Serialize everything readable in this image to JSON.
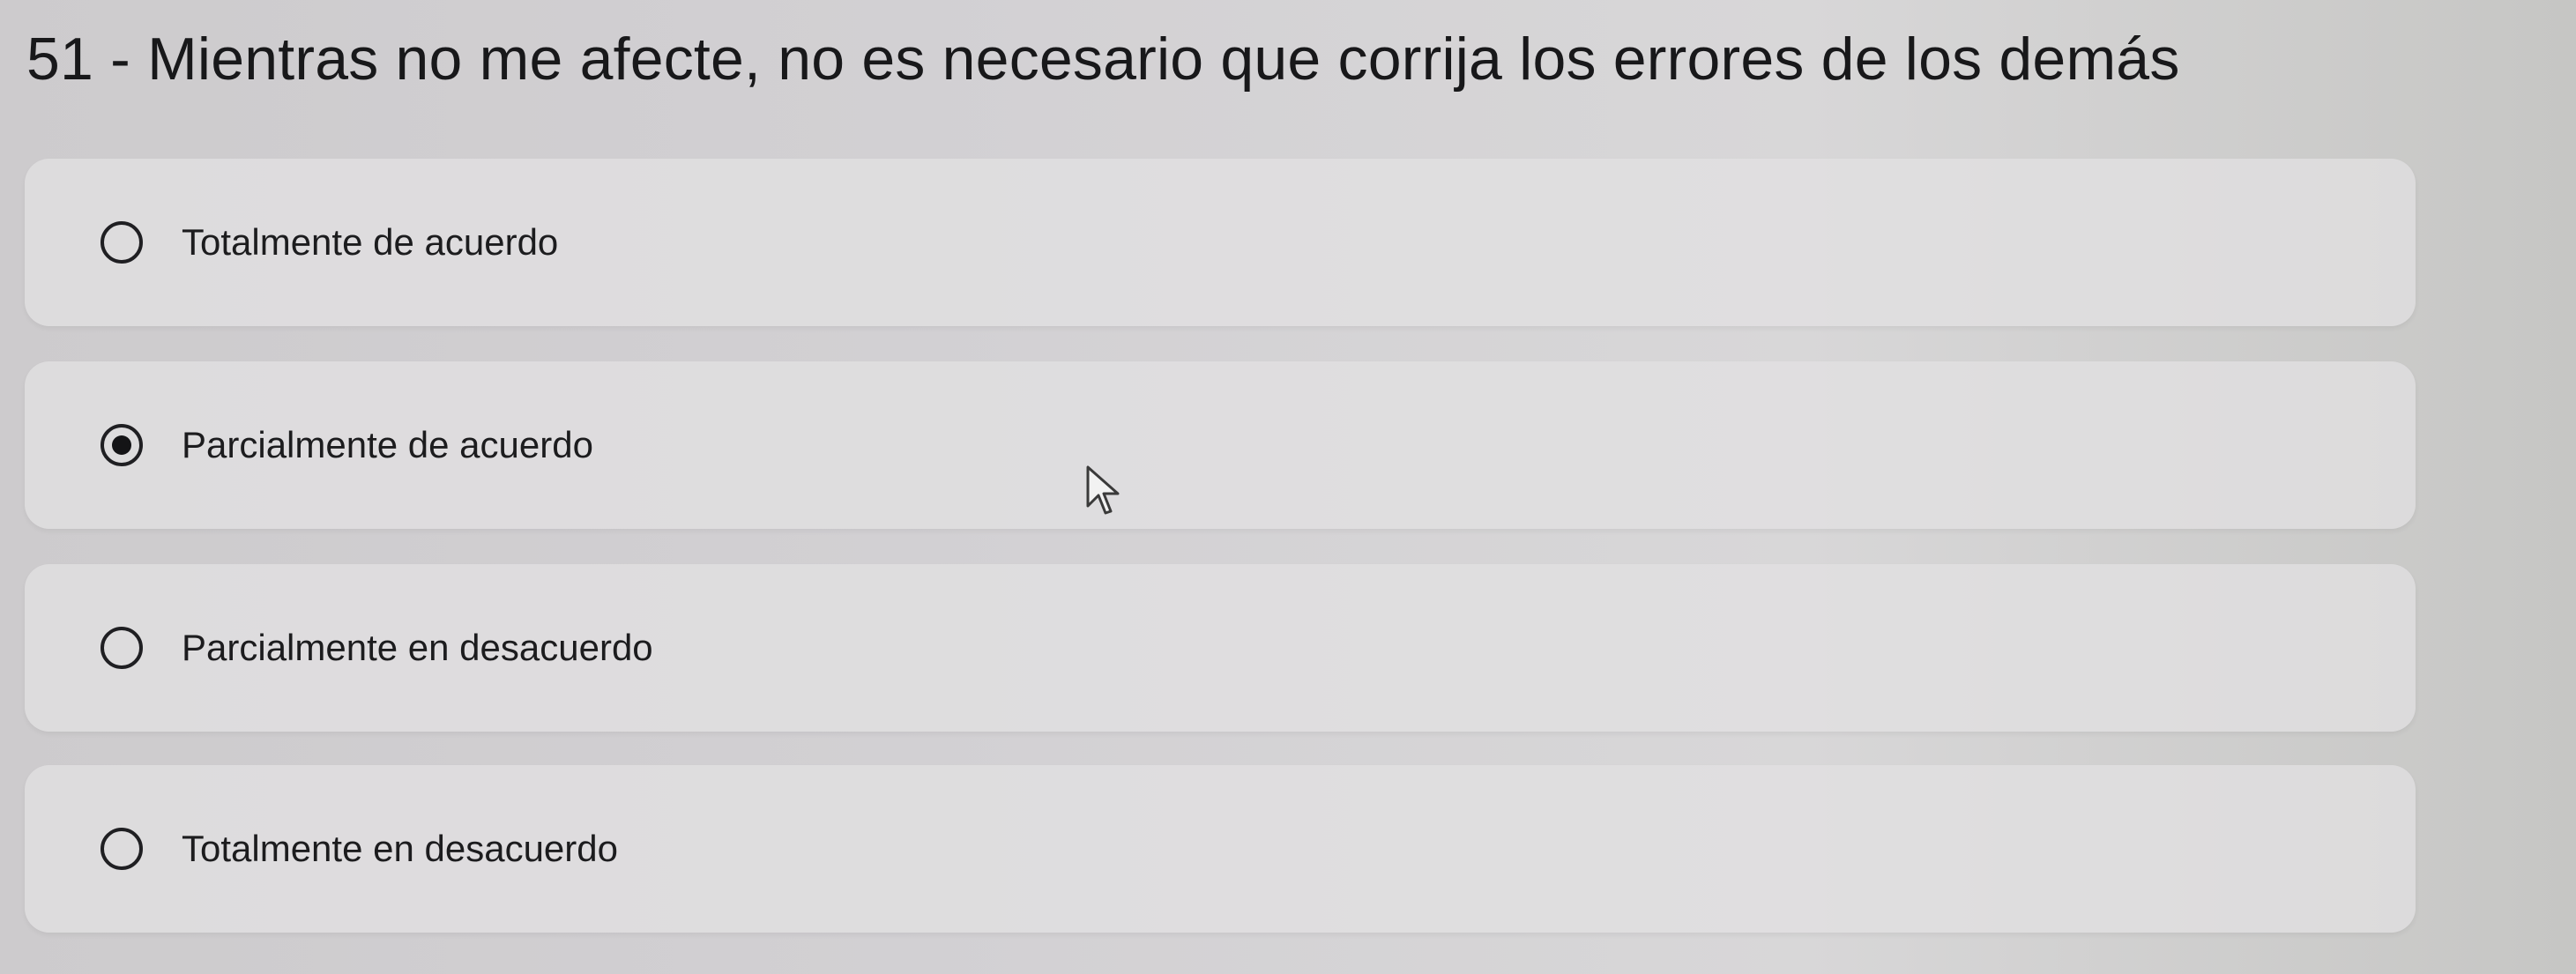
{
  "question": {
    "title": "51 - Mientras no me afecte, no es necesario que corrija los errores de los demás"
  },
  "options": [
    {
      "label": "Totalmente de acuerdo",
      "selected": false
    },
    {
      "label": "Parcialmente de acuerdo",
      "selected": true
    },
    {
      "label": "Parcialmente en desacuerdo",
      "selected": false
    },
    {
      "label": "Totalmente en desacuerdo",
      "selected": false
    }
  ],
  "icons": {
    "pointer": "mouse-pointer-icon"
  },
  "colors": {
    "text": "#1c1c1e",
    "option_background": "#e2e0e2",
    "radio": "#1f1f22"
  }
}
